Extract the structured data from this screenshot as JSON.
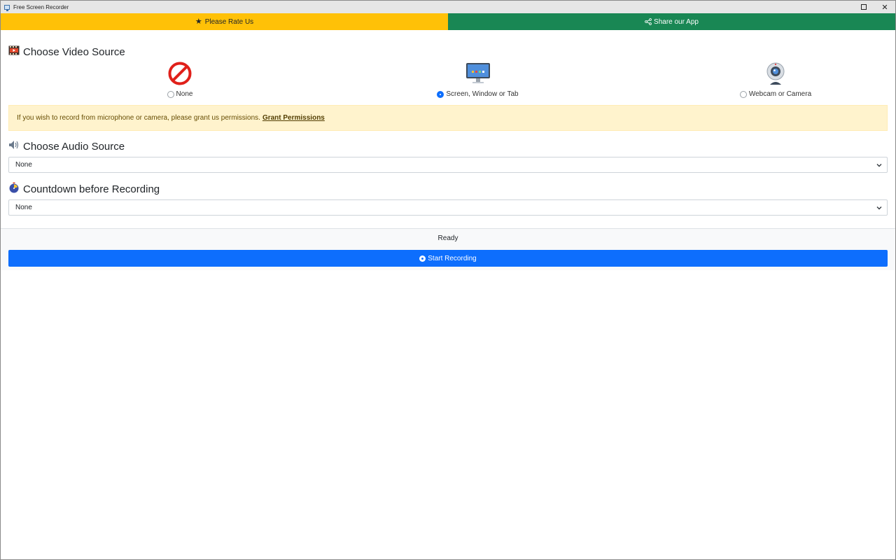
{
  "window": {
    "title": "Free Screen Recorder",
    "maximize_icon": "maximize-icon",
    "close_glyph": "✕"
  },
  "topbar": {
    "rate_label": "Please Rate Us",
    "rate_icon": "star-icon",
    "share_label": "Share our App",
    "share_icon": "share-icon",
    "rate_color": "#ffc107",
    "share_color": "#198754"
  },
  "video": {
    "heading": "Choose Video Source",
    "heading_icon": "film-icon",
    "options": [
      {
        "label": "None",
        "icon": "prohibited-icon",
        "selected": false
      },
      {
        "label": "Screen, Window or Tab",
        "icon": "monitor-icon",
        "selected": true
      },
      {
        "label": "Webcam or Camera",
        "icon": "webcam-icon",
        "selected": false
      }
    ]
  },
  "alert": {
    "text": "If you wish to record from microphone or camera, please grant us permissions.",
    "link_label": "Grant Permissions"
  },
  "audio": {
    "heading": "Choose Audio Source",
    "heading_icon": "speaker-icon",
    "selected": "None"
  },
  "countdown": {
    "heading": "Countdown before Recording",
    "heading_icon": "timer-icon",
    "selected": "None"
  },
  "footer": {
    "status": "Ready",
    "start_label": "Start Recording",
    "start_icon": "record-icon",
    "accent": "#0d6efd"
  }
}
